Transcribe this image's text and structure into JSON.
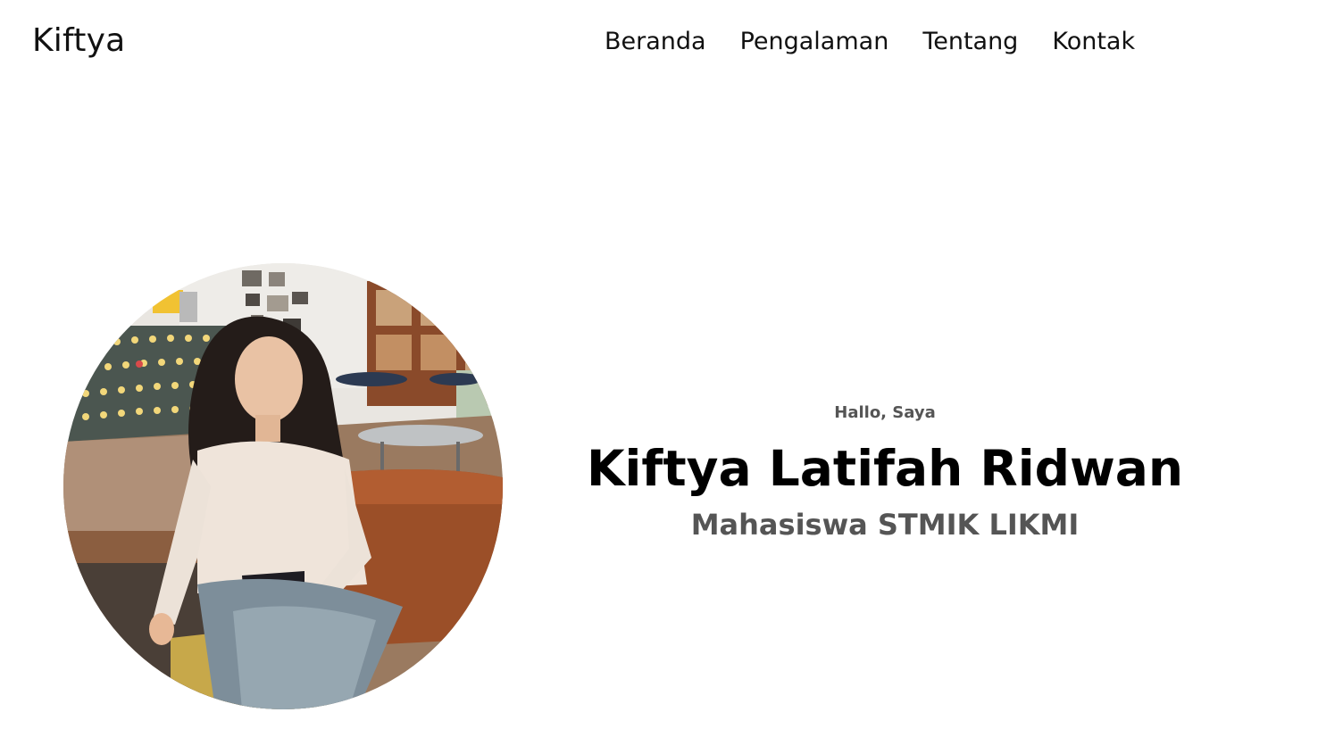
{
  "navbar": {
    "logo": "Kiftya",
    "links": [
      "Beranda",
      "Pengalaman",
      "Tentang",
      "Kontak"
    ]
  },
  "hero": {
    "greeting": "Hallo, Saya",
    "name": "Kiftya Latifah Ridwan",
    "role": "Mahasiswa STMIK LIKMI"
  },
  "colors": {
    "background": "#ffffff",
    "text_primary": "#000000",
    "text_secondary": "#555555"
  }
}
